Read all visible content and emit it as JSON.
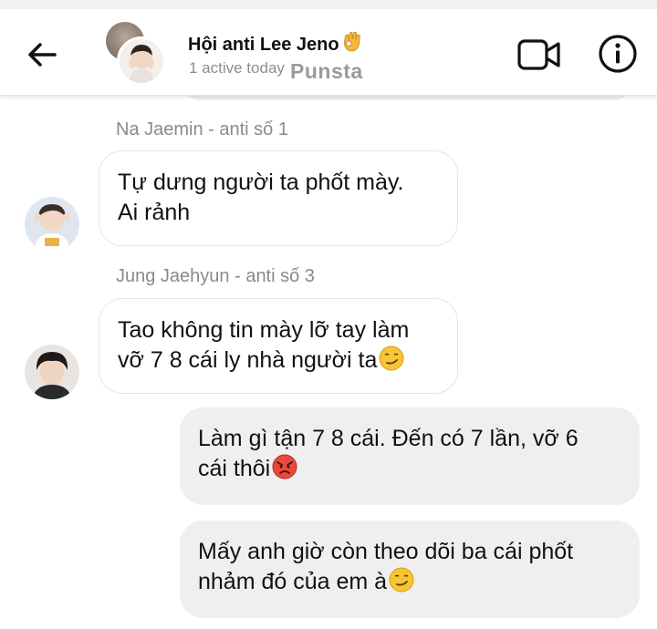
{
  "header": {
    "title": "Hội anti Lee Jeno",
    "status": "1 active today",
    "watermark": "Punsta"
  },
  "messages": [
    {
      "sender": "Na Jaemin - anti số 1",
      "lines": [
        "Tự dưng người ta phốt mày.",
        "Ai rảnh"
      ]
    },
    {
      "sender": "Jung Jaehyun - anti số 3",
      "lines": [
        "Tao không tin mày lỡ tay làm",
        "vỡ 7 8 cái ly nhà người ta"
      ]
    },
    {
      "lines": [
        "Làm gì tận 7 8 cái. Đến có 7 lần, vỡ 6",
        "cái thôi"
      ]
    },
    {
      "lines": [
        "Mấy anh giờ còn theo dõi ba cái phốt",
        "nhảm đó của em à"
      ]
    }
  ],
  "colors": {
    "outgoing_bubble": "#efefef",
    "incoming_bubble_border": "#e6e6e6",
    "sender_name": "#8a8a8a"
  },
  "icons": {
    "back": "arrow-left-icon",
    "video": "video-camera-icon",
    "info": "info-icon",
    "emojis": [
      "ok-hand-emoji",
      "smirk-emoji",
      "angry-emoji"
    ]
  }
}
